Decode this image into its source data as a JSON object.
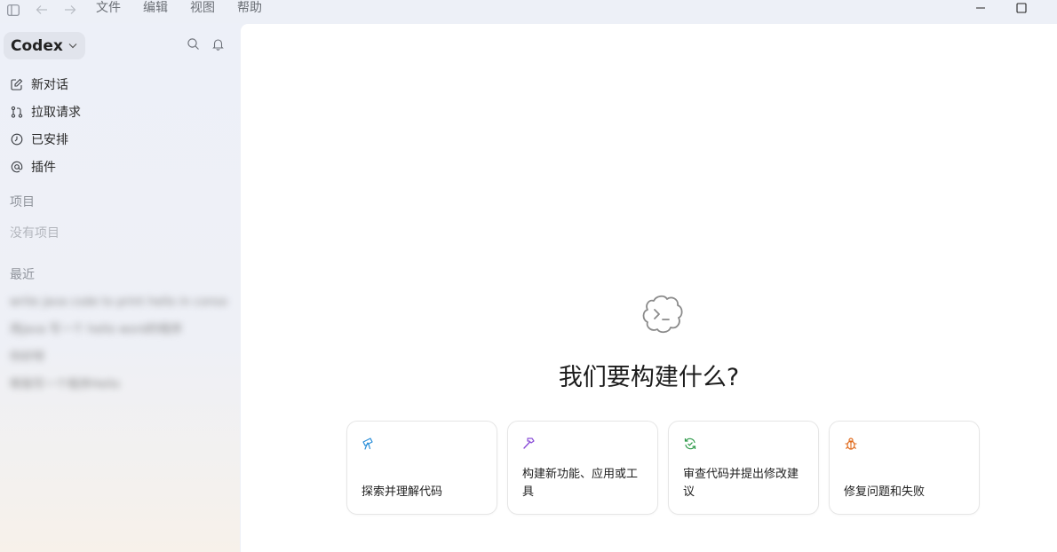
{
  "menu": [
    "文件",
    "编辑",
    "视图",
    "帮助"
  ],
  "sidebar": {
    "brand": "Codex",
    "nav": [
      {
        "label": "新对话",
        "icon": "new-chat-icon"
      },
      {
        "label": "拉取请求",
        "icon": "pull-request-icon"
      },
      {
        "label": "已安排",
        "icon": "clock-icon"
      },
      {
        "label": "插件",
        "icon": "at-icon"
      }
    ],
    "projects_label": "项目",
    "projects_empty": "没有项目",
    "recent_label": "最近",
    "recent": [
      "write java code to print hello in console",
      "用java 写一个 hello word的程序",
      "你好呀",
      "帮我写一个程序Hello"
    ]
  },
  "main": {
    "title": "我们要构建什么?",
    "cards": [
      {
        "label": "探索并理解代码",
        "icon": "telescope-icon",
        "color": "#2b8fd9"
      },
      {
        "label": "构建新功能、应用或工具",
        "icon": "hammer-icon",
        "color": "#8b4fd8"
      },
      {
        "label": "审查代码并提出修改建议",
        "icon": "review-refresh-icon",
        "color": "#2e9a4a"
      },
      {
        "label": "修复问题和失败",
        "icon": "bug-icon",
        "color": "#e06a1c"
      }
    ]
  }
}
